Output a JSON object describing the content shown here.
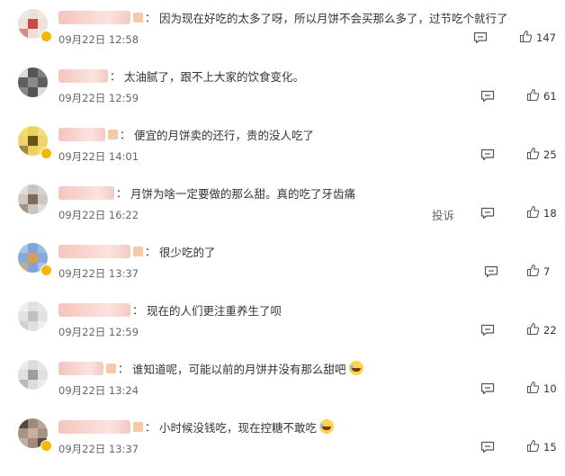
{
  "comments": [
    {
      "text": "因为现在好吃的太多了呀，所以月饼不会买那么多了，过节吃个就行了",
      "date": "09月22日 12:58",
      "likes": "147",
      "avatar_colors": [
        "#e8d7cf",
        "#c94a47",
        "#efe7e3"
      ],
      "badge": true,
      "emoji": false,
      "report": ""
    },
    {
      "text": "太油腻了，跟不上大家的饮食变化。",
      "date": "09月22日 12:59",
      "likes": "61",
      "avatar_colors": [
        "#2b2b2b",
        "#8a8a8a",
        "#dcdcdc"
      ],
      "badge": false,
      "emoji": false,
      "report": ""
    },
    {
      "text": "便宜的月饼卖的还行，贵的没人吃了",
      "date": "09月22日 14:01",
      "likes": "25",
      "avatar_colors": [
        "#e9c43a",
        "#6b5314",
        "#f4dc6a"
      ],
      "badge": true,
      "emoji": false,
      "report": ""
    },
    {
      "text": "月饼为啥一定要做的那么甜。真的吃了牙齿痛",
      "date": "09月22日 16:22",
      "likes": "18",
      "avatar_colors": [
        "#bdb5ad",
        "#7c6a5f",
        "#e3ddd7"
      ],
      "badge": false,
      "emoji": false,
      "report": "投诉"
    },
    {
      "text": "很少吃的了",
      "date": "09月22日 13:37",
      "likes": "7",
      "avatar_colors": [
        "#5e8ecf",
        "#d6a14d",
        "#a7c4e8"
      ],
      "badge": true,
      "emoji": false,
      "report": ""
    },
    {
      "text": "现在的人们更注重养生了呗",
      "date": "09月22日 12:59",
      "likes": "22",
      "avatar_colors": [
        "#d9d9d9",
        "#bfbfbf",
        "#efefef"
      ],
      "badge": false,
      "emoji": false,
      "report": ""
    },
    {
      "text": "谁知道呢，可能以前的月饼并没有那么甜吧",
      "date": "09月22日 13:24",
      "likes": "10",
      "avatar_colors": [
        "#d4d4d4",
        "#9d9d9d",
        "#ebebeb"
      ],
      "badge": false,
      "emoji": true,
      "report": ""
    },
    {
      "text": "小时候没钱吃，现在控糖不敢吃",
      "date": "09月22日 13:37",
      "likes": "15",
      "avatar_colors": [
        "#8a6d5a",
        "#c9b09e",
        "#5a4638"
      ],
      "badge": true,
      "emoji": true,
      "report": ""
    }
  ],
  "colors": {
    "text": "#333333",
    "meta": "#666666",
    "badge": "#f5b700",
    "name_blur": "#f6c4bd"
  },
  "icons": {
    "comment": "comment-icon",
    "like": "thumbs-up-icon"
  }
}
